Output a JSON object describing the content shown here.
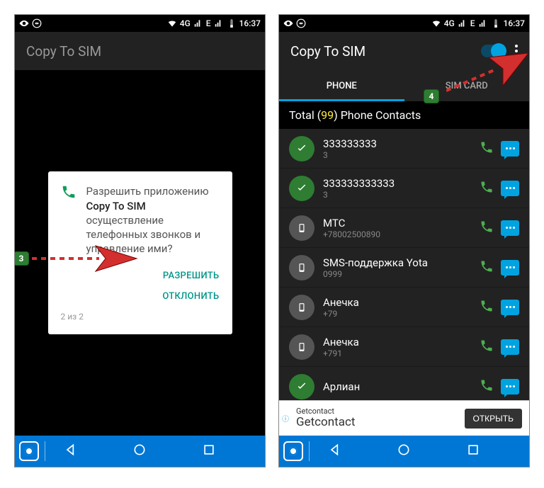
{
  "status": {
    "net": "4G",
    "extra": "E",
    "time": "16:37"
  },
  "appbar": {
    "title": "Copy To SIM"
  },
  "dialog": {
    "prefix": "Разрешить приложению ",
    "app": "Copy To SIM",
    "suffix": " осуществление телефонных звонков и управление ими?",
    "allow": "РАЗРЕШИТЬ",
    "deny": "ОТКЛОНИТЬ",
    "pager": "2 из 2"
  },
  "badges": {
    "b1": "3",
    "b2": "4"
  },
  "tabs": {
    "phone": "PHONE",
    "sim": "SIM CARD"
  },
  "summary": {
    "pre": "Total (",
    "count": "99",
    "post": ") Phone Contacts"
  },
  "contacts": [
    {
      "name": "333333333",
      "num": "3",
      "checked": true
    },
    {
      "name": "333333333333",
      "num": "3",
      "checked": true
    },
    {
      "name": "МТС",
      "num": "+78002500890",
      "checked": false
    },
    {
      "name": "SMS-поддержка Yota",
      "num": "0999",
      "checked": false
    },
    {
      "name": "Анечка",
      "num": "+79",
      "checked": false
    },
    {
      "name": "Анечка",
      "num": "+791",
      "checked": false
    },
    {
      "name": "Арлиан",
      "num": "",
      "checked": true
    }
  ],
  "ad": {
    "small": "Getcontact",
    "big": "Getcontact",
    "btn": "ОТКРЫТЬ"
  }
}
